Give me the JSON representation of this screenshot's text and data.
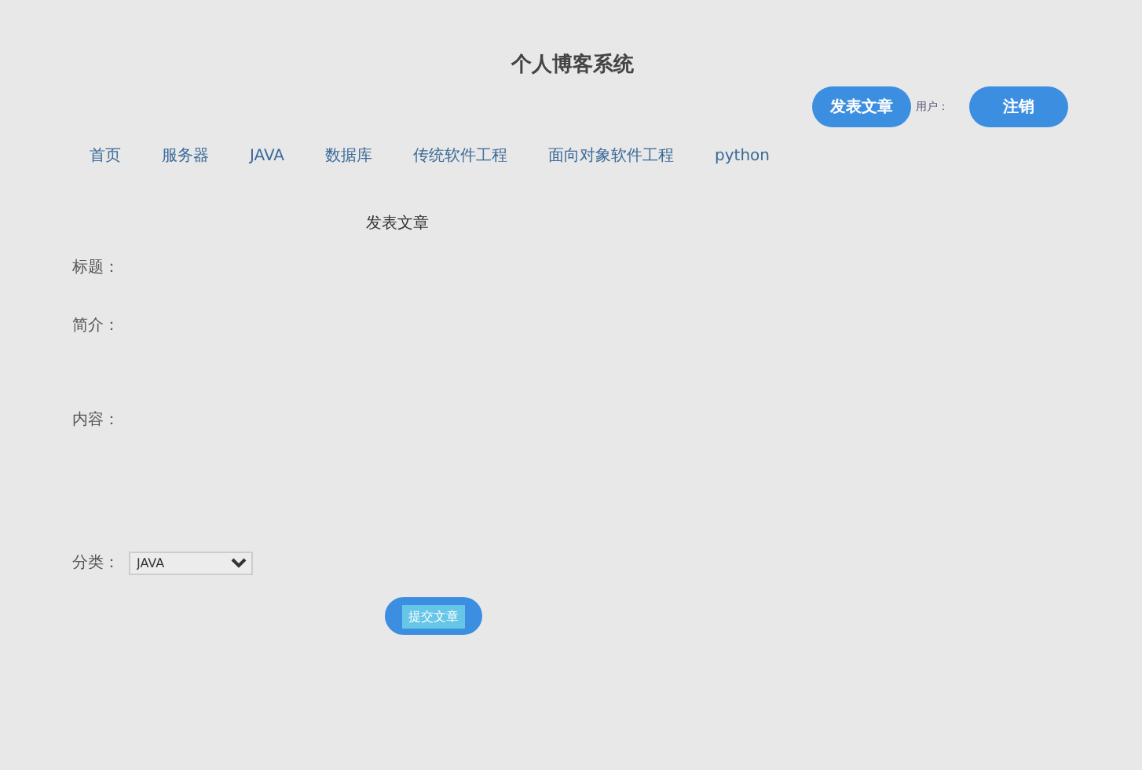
{
  "header": {
    "title": "个人博客系统",
    "post_button": "发表文章",
    "user_label": "用户：",
    "logout_button": "注销"
  },
  "nav": [
    {
      "label": "首页"
    },
    {
      "label": "服务器"
    },
    {
      "label": "JAVA"
    },
    {
      "label": "数据库"
    },
    {
      "label": "传统软件工程"
    },
    {
      "label": "面向对象软件工程"
    },
    {
      "label": "python"
    }
  ],
  "form": {
    "heading": "发表文章",
    "fields": [
      {
        "kind": "text",
        "label": "标题："
      },
      {
        "kind": "text",
        "label": "简介："
      },
      {
        "kind": "textarea",
        "label": "内容："
      },
      {
        "kind": "select",
        "label": "分类：",
        "value": "JAVA"
      }
    ],
    "submit": "提交文章"
  }
}
